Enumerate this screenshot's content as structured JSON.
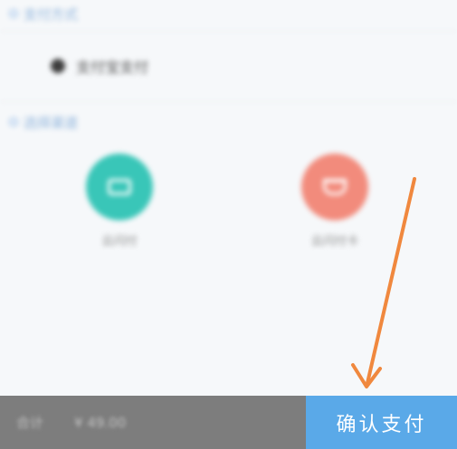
{
  "sections": {
    "payment_method": {
      "title": "支付方式"
    },
    "payment_channel": {
      "title": "选择渠道"
    }
  },
  "payment_method": {
    "selected_label": "支付宝支付"
  },
  "channels": [
    {
      "label": "云闪付",
      "color": "#39c6b8",
      "icon": "wallet-icon"
    },
    {
      "label": "云闪付卡",
      "color": "#f28b7c",
      "icon": "cup-icon"
    }
  ],
  "bottom_bar": {
    "total_label": "合计",
    "total_amount": "¥ 49.00",
    "confirm_label": "确认支付",
    "confirm_color": "#5aa9e8",
    "total_bg_color": "#7d7d7d"
  },
  "annotation": {
    "arrow_color": "#f0883e"
  }
}
